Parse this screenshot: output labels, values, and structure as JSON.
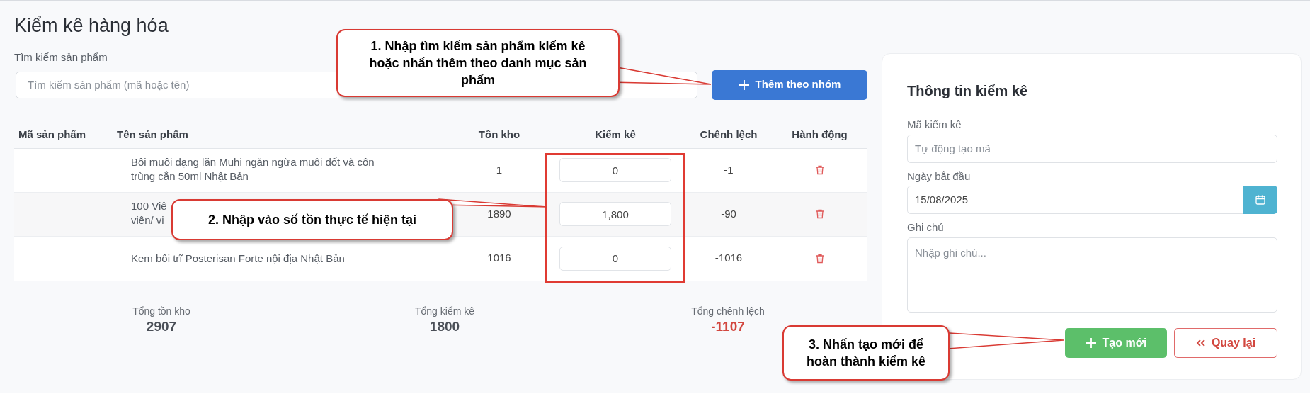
{
  "page": {
    "title": "Kiểm kê hàng hóa"
  },
  "search": {
    "label": "Tìm kiếm sản phẩm",
    "placeholder": "Tìm kiếm sản phẩm (mã hoặc tên)",
    "add_button": "Thêm theo nhóm"
  },
  "table": {
    "columns": [
      "Mã sản phẩm",
      "Tên sản phẩm",
      "Tồn kho",
      "Kiểm kê",
      "Chênh lệch",
      "Hành động"
    ],
    "rows": [
      {
        "name": "Bôi muỗi dạng lăn Muhi ngăn ngừa muỗi đốt và côn trùng cắn 50ml Nhật Bản",
        "stock": "1",
        "count": "0",
        "diff": "-1"
      },
      {
        "name": "100 Viê\nviên/ vi",
        "stock": "1890",
        "count": "1,800",
        "diff": "-90"
      },
      {
        "name": "Kem bôi trĩ Posterisan Forte nội địa Nhật Bản",
        "stock": "1016",
        "count": "0",
        "diff": "-1016"
      }
    ]
  },
  "totals": [
    {
      "label": "Tổng tồn kho",
      "value": "2907",
      "kind": "plain"
    },
    {
      "label": "Tổng kiểm kê",
      "value": "1800",
      "kind": "plain"
    },
    {
      "label": "Tổng chênh lệch",
      "value": "-1107",
      "kind": "negative"
    }
  ],
  "info_panel": {
    "title": "Thông tin kiểm kê",
    "code_label": "Mã kiểm kê",
    "code_placeholder": "Tự động tạo mã",
    "date_label": "Ngày bắt đầu",
    "date_value": "15/08/2025",
    "note_label": "Ghi chú",
    "note_placeholder": "Nhập ghi chú...",
    "create_button": "Tạo mới",
    "back_button": "Quay lại"
  },
  "annotations": [
    {
      "text": "1. Nhập tìm kiếm sản phẩm kiểm kê hoặc nhấn thêm theo danh mục sản phẩm"
    },
    {
      "text": "2. Nhập vào số tồn thực tế hiện tại"
    },
    {
      "text": "3. Nhấn tạo mới để hoàn thành kiểm kê"
    }
  ]
}
